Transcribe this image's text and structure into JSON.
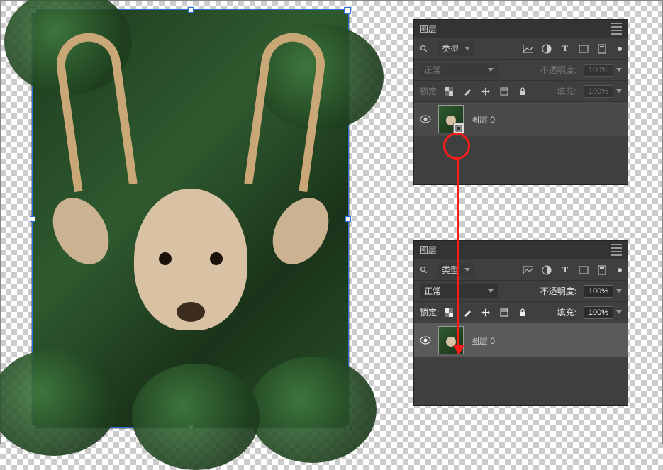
{
  "panel_title": "图层",
  "filter_label": "类型",
  "blend_mode": "正常",
  "opacity_label": "不透明度:",
  "opacity_value_disabled": "100%",
  "opacity_value_enabled": "100%",
  "lock_label": "锁定:",
  "fill_label": "填充:",
  "fill_value_disabled": "100%",
  "fill_value_enabled": "100%",
  "layer": {
    "name": "图层 0",
    "smart_object": true
  },
  "icons": {
    "search": "search",
    "menu": "menu",
    "eye": "eye",
    "image_filter": "image",
    "adjust_filter": "adjust",
    "type_filter": "T",
    "shape_filter": "shape",
    "smart_filter": "smart",
    "lock_pixels": "checker",
    "lock_brush": "brush",
    "lock_move": "move",
    "lock_artboard": "artboard",
    "lock_all": "lock"
  },
  "annotation": {
    "highlight": "smart-object-badge",
    "arrow_to": "layer-thumbnail-no-smart-object"
  }
}
